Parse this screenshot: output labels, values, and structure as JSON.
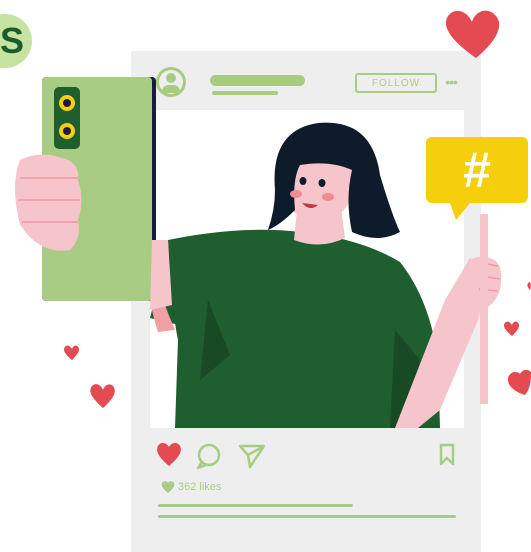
{
  "post": {
    "follow_label": "FOLLOW",
    "more_label": "•••",
    "likes": "362 likes"
  },
  "badge": {
    "text": "S"
  },
  "hashtag": {
    "symbol": "#"
  },
  "colors": {
    "accent_green": "#a9cc85",
    "dark_green": "#1e5e2f",
    "heart_red": "#e34a51",
    "hashtag_yellow": "#f5cf0c",
    "card_gray": "#eeeeee"
  }
}
